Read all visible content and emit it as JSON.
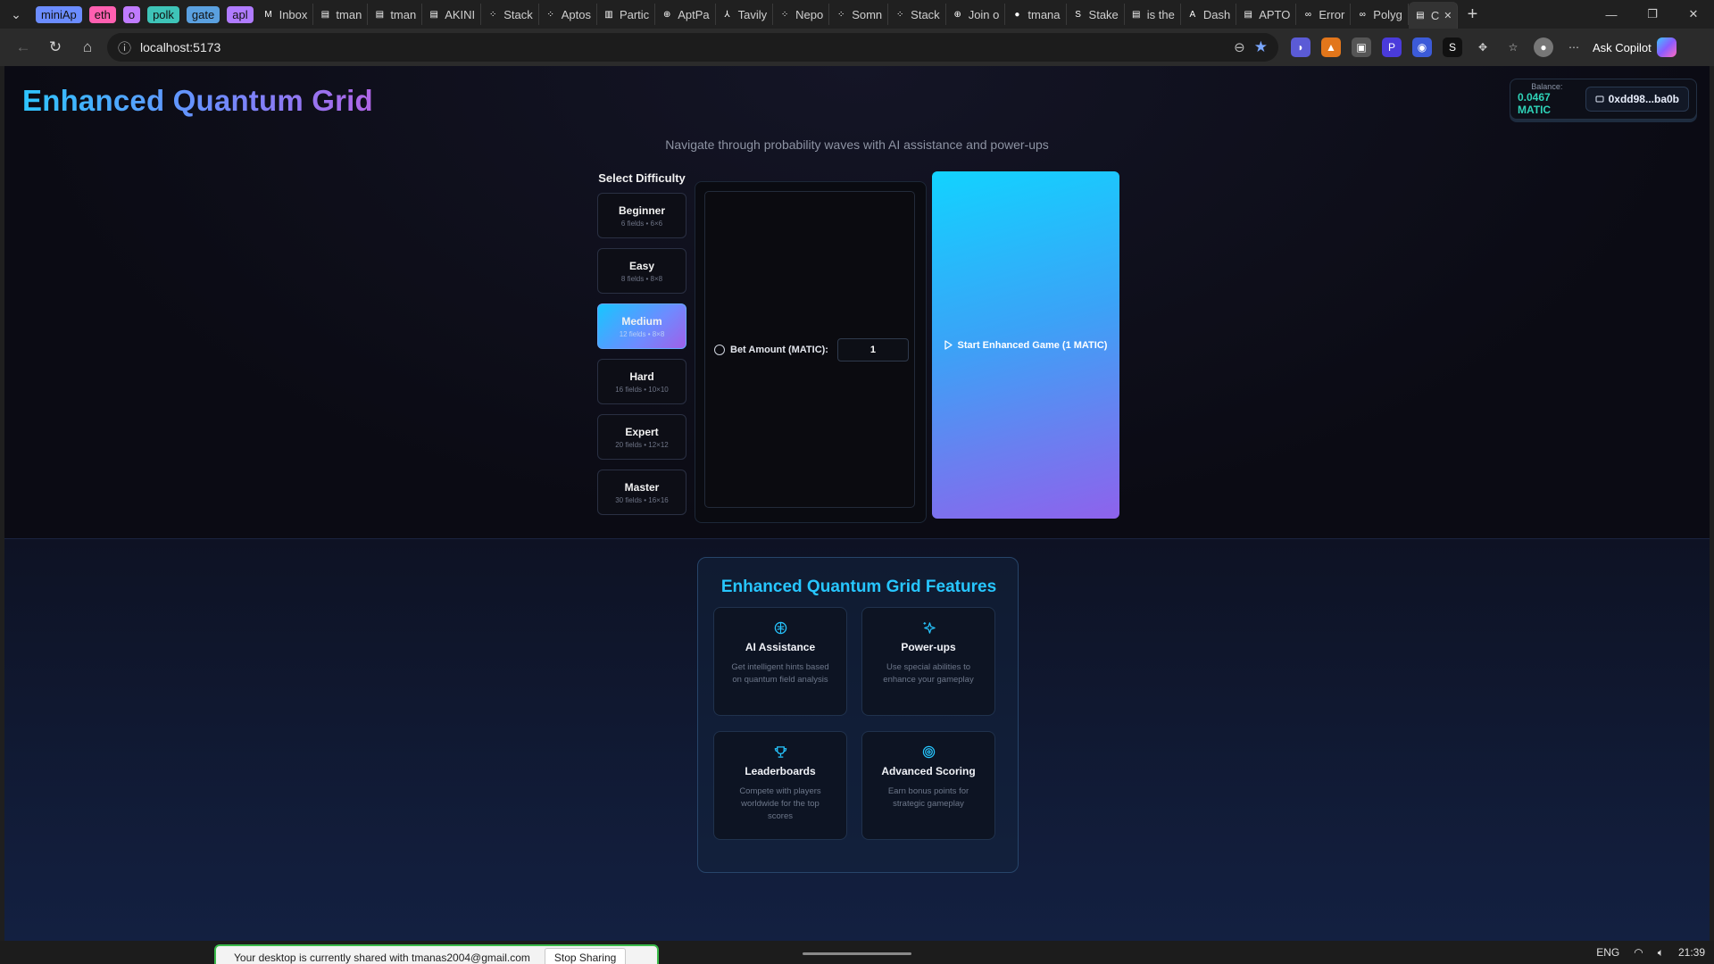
{
  "browser": {
    "tabs": [
      {
        "label": "miniAp",
        "color": "#6b8cff",
        "kind": "pill"
      },
      {
        "label": "eth",
        "color": "#ff5fb0",
        "kind": "pill"
      },
      {
        "label": "o",
        "color": "#c07bff",
        "kind": "pill"
      },
      {
        "label": "polk",
        "color": "#3ec4b8",
        "kind": "pill"
      },
      {
        "label": "gate",
        "color": "#5aa0e0",
        "kind": "pill"
      },
      {
        "label": "apl",
        "color": "#b07bff",
        "kind": "pill"
      },
      {
        "label": "Inbox",
        "icon": "gmail-icon"
      },
      {
        "label": "tman",
        "icon": "page-icon"
      },
      {
        "label": "tman",
        "icon": "page-icon"
      },
      {
        "label": "AKINI",
        "icon": "page-icon"
      },
      {
        "label": "Stack",
        "icon": "dots-icon"
      },
      {
        "label": "Aptos",
        "icon": "dots-icon"
      },
      {
        "label": "Partic",
        "icon": "doc-icon"
      },
      {
        "label": "AptPa",
        "icon": "globe-icon"
      },
      {
        "label": "Tavily",
        "icon": "tavily-icon"
      },
      {
        "label": "Nepo",
        "icon": "dots-icon"
      },
      {
        "label": "Somn",
        "icon": "dots-icon"
      },
      {
        "label": "Stack",
        "icon": "dots-icon"
      },
      {
        "label": "Join o",
        "icon": "globe-icon"
      },
      {
        "label": "tmana",
        "icon": "github-icon"
      },
      {
        "label": "Stake",
        "icon": "s-icon"
      },
      {
        "label": "is the",
        "icon": "page-icon"
      },
      {
        "label": "Dash",
        "icon": "a-icon"
      },
      {
        "label": "APTO",
        "icon": "page-icon"
      },
      {
        "label": "Error",
        "icon": "link-icon"
      },
      {
        "label": "Polyg",
        "icon": "link-icon"
      },
      {
        "label": "C",
        "icon": "page-icon",
        "active": true
      }
    ],
    "url": "localhost:5173",
    "ask_copilot": "Ask Copilot"
  },
  "app": {
    "title": "Enhanced Quantum Grid",
    "subtitle": "Navigate through probability waves with AI assistance and power-ups",
    "wallet": {
      "balance_label": "Balance:",
      "balance_value": "0.0467 MATIC",
      "address": "0xdd98...ba0b"
    },
    "difficulty": {
      "heading": "Select Difficulty",
      "levels": [
        {
          "name": "Beginner",
          "info": "6 fields • 6×6"
        },
        {
          "name": "Easy",
          "info": "8 fields • 8×8"
        },
        {
          "name": "Medium",
          "info": "12 fields • 8×8",
          "selected": true
        },
        {
          "name": "Hard",
          "info": "16 fields • 10×10"
        },
        {
          "name": "Expert",
          "info": "20 fields • 12×12"
        },
        {
          "name": "Master",
          "info": "30 fields • 16×16"
        }
      ]
    },
    "bet": {
      "label": "Bet Amount (MATIC):",
      "value": "1"
    },
    "start_label": "Start Enhanced Game (1 MATIC)",
    "features": {
      "title": "Enhanced Quantum Grid Features",
      "items": [
        {
          "icon": "brain-icon",
          "title": "AI Assistance",
          "desc": "Get intelligent hints based on quantum field analysis"
        },
        {
          "icon": "sparkles-icon",
          "title": "Power-ups",
          "desc": "Use special abilities to enhance your gameplay"
        },
        {
          "icon": "trophy-icon",
          "title": "Leaderboards",
          "desc": "Compete with players worldwide for the top scores"
        },
        {
          "icon": "target-icon",
          "title": "Advanced Scoring",
          "desc": "Earn bonus points for strategic gameplay"
        }
      ]
    }
  },
  "system": {
    "share_message": "Your desktop is currently shared with tmanas2004@gmail.com",
    "stop_sharing": "Stop Sharing",
    "language": "ENG",
    "time": "21:39"
  }
}
